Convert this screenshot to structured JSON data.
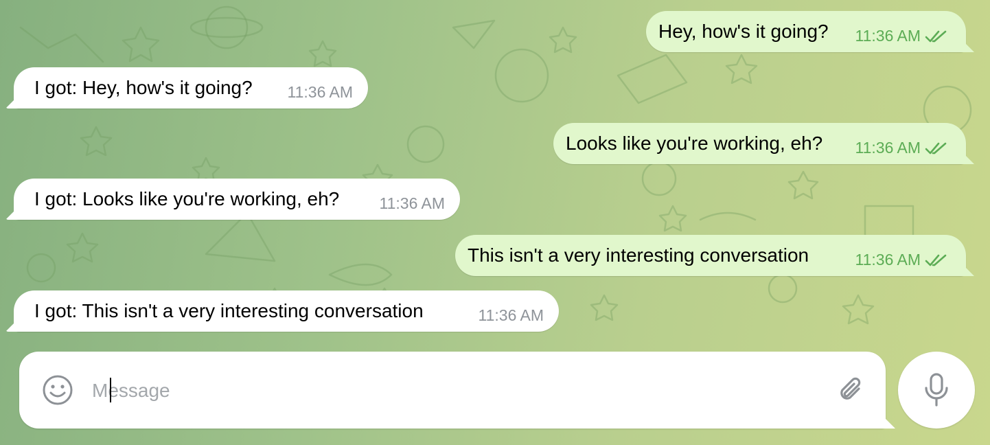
{
  "colors": {
    "incoming_bubble": "#ffffff",
    "outgoing_bubble": "#e1f7cc",
    "outgoing_meta": "#5cac55",
    "incoming_meta": "#8e9399"
  },
  "messages": [
    {
      "direction": "outgoing",
      "text": "Hey, how's it going?",
      "time": "11:36 AM",
      "status_icon": "double-check-icon"
    },
    {
      "direction": "incoming",
      "text": "I got: Hey, how's it going?",
      "time": "11:36 AM"
    },
    {
      "direction": "outgoing",
      "text": "Looks like you're working, eh?",
      "time": "11:36 AM",
      "status_icon": "double-check-icon"
    },
    {
      "direction": "incoming",
      "text": "I got: Looks like you're working, eh?",
      "time": "11:36 AM"
    },
    {
      "direction": "outgoing",
      "text": "This isn't a very interesting conversation",
      "time": "11:36 AM",
      "status_icon": "double-check-icon"
    },
    {
      "direction": "incoming",
      "text": "I got: This isn't a very interesting conversation",
      "time": "11:36 AM"
    }
  ],
  "composer": {
    "placeholder": "Message",
    "value": "",
    "emoji_icon": "smiley-icon",
    "attach_icon": "paperclip-icon",
    "mic_icon": "microphone-icon"
  }
}
